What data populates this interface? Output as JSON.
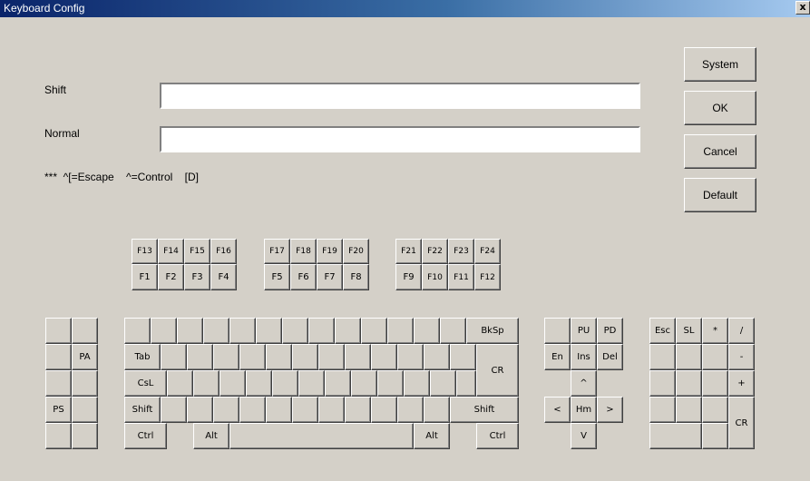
{
  "window": {
    "title": "Keyboard Config",
    "close_label": "x"
  },
  "labels": {
    "shift": "Shift",
    "normal": "Normal",
    "hint": "***  ^[=Escape    ^=Control    [D]"
  },
  "fields": {
    "shift_value": "",
    "normal_value": ""
  },
  "buttons": {
    "system": "System",
    "ok": "OK",
    "cancel": "Cancel",
    "default": "Default"
  },
  "fkeys": {
    "g1_top": [
      "F13",
      "F14",
      "F15",
      "F16"
    ],
    "g1_bot": [
      "F1",
      "F2",
      "F3",
      "F4"
    ],
    "g2_top": [
      "F17",
      "F18",
      "F19",
      "F20"
    ],
    "g2_bot": [
      "F5",
      "F6",
      "F7",
      "F8"
    ],
    "g3_top": [
      "F21",
      "F22",
      "F23",
      "F24"
    ],
    "g3_bot": [
      "F9",
      "F10",
      "F11",
      "F12"
    ]
  },
  "left_block": {
    "pa": "PA",
    "ps": "PS"
  },
  "main_keys": {
    "bksp": "BkSp",
    "tab": "Tab",
    "cr": "CR",
    "csl": "CsL",
    "shift_l": "Shift",
    "shift_r": "Shift",
    "ctrl_l": "Ctrl",
    "alt_l": "Alt",
    "alt_r": "Alt",
    "ctrl_r": "Ctrl"
  },
  "nav_keys": {
    "pu": "PU",
    "pd": "PD",
    "en": "En",
    "ins": "Ins",
    "del": "Del",
    "up": "^",
    "left": "<",
    "hm": "Hm",
    "right": ">",
    "down": "V"
  },
  "numpad": {
    "esc": "Esc",
    "sl": "SL",
    "star": "*",
    "slash": "/",
    "minus": "-",
    "plus": "+",
    "cr": "CR"
  }
}
